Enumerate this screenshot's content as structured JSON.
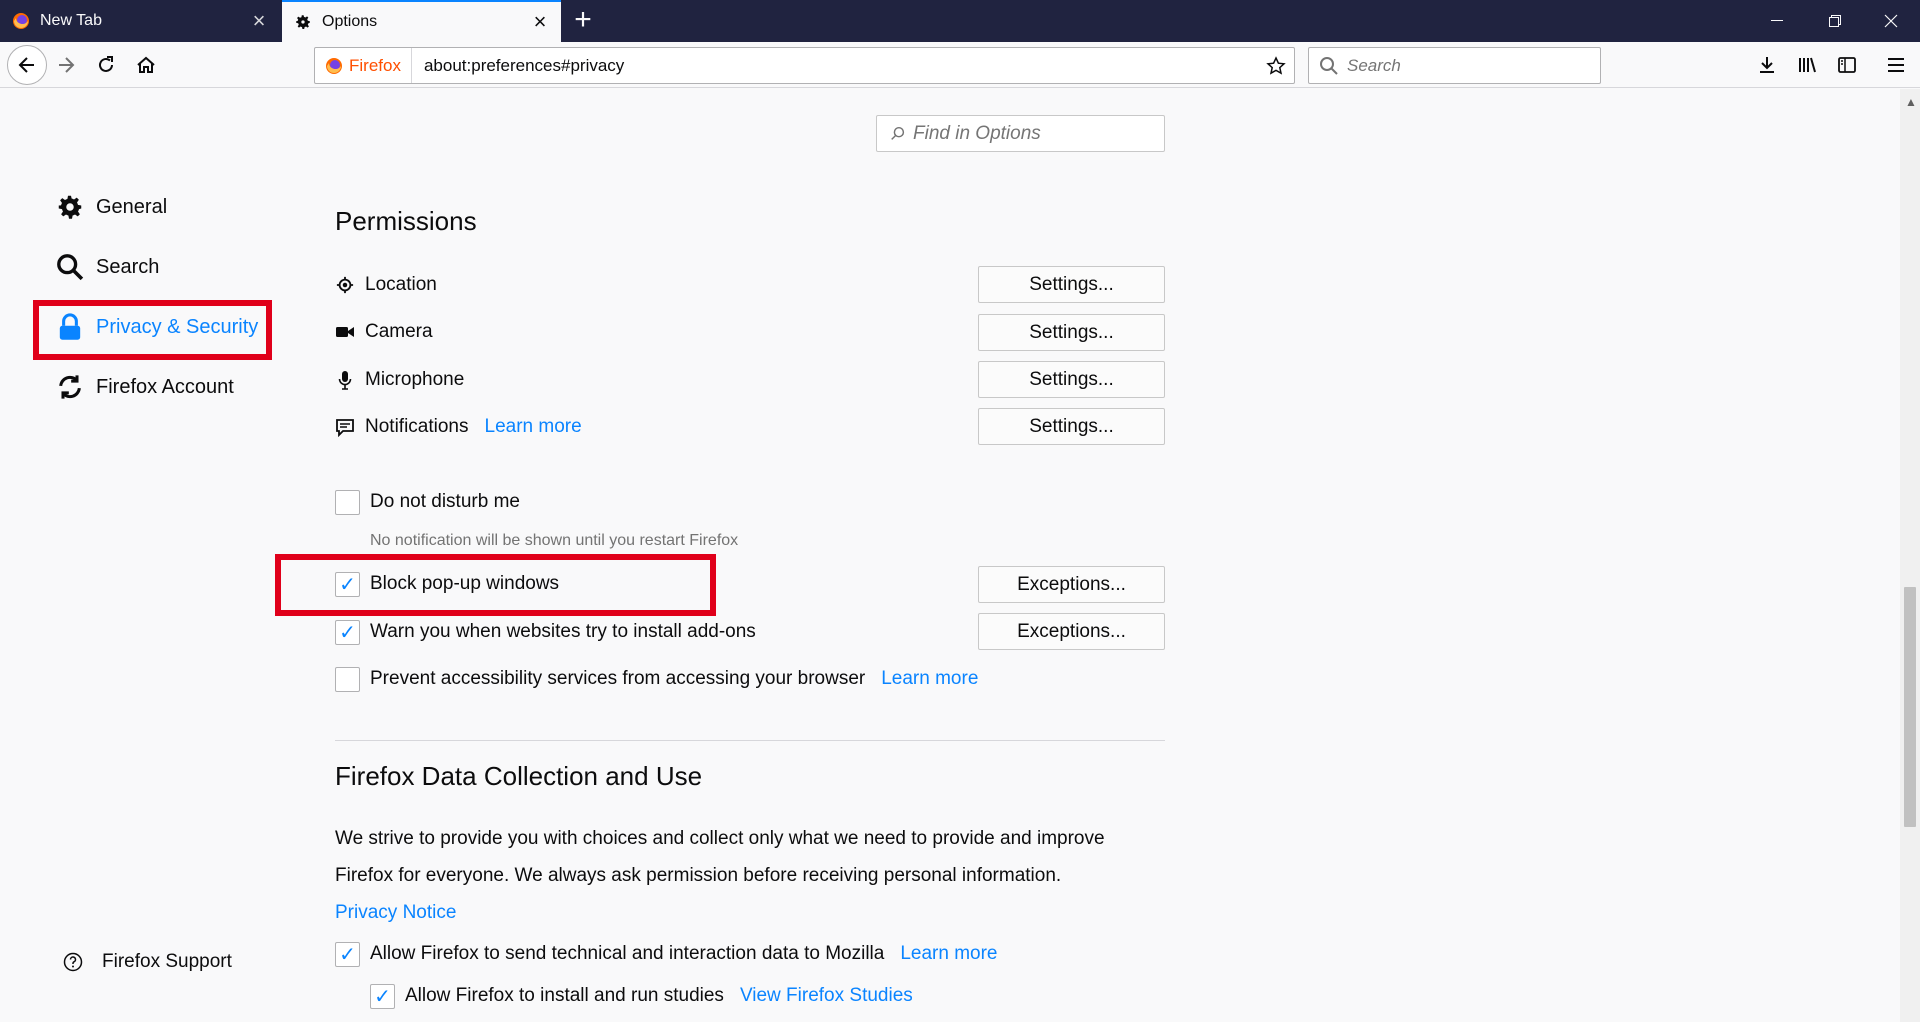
{
  "tabs": [
    {
      "title": "New Tab",
      "active": false
    },
    {
      "title": "Options",
      "active": true
    }
  ],
  "toolbar": {
    "identity_label": "Firefox",
    "url": "about:preferences#privacy",
    "search_placeholder": "Search"
  },
  "find": {
    "placeholder": "Find in Options"
  },
  "sidebar": {
    "items": [
      {
        "label": "General",
        "icon": "gear-icon"
      },
      {
        "label": "Search",
        "icon": "search-icon"
      },
      {
        "label": "Privacy & Security",
        "icon": "lock-icon",
        "selected": true
      },
      {
        "label": "Firefox Account",
        "icon": "sync-icon"
      }
    ],
    "support_label": "Firefox Support"
  },
  "permissions": {
    "heading": "Permissions",
    "rows": [
      {
        "label": "Location",
        "icon": "location-icon",
        "button": "Settings..."
      },
      {
        "label": "Camera",
        "icon": "camera-icon",
        "button": "Settings..."
      },
      {
        "label": "Microphone",
        "icon": "microphone-icon",
        "button": "Settings..."
      },
      {
        "label": "Notifications",
        "icon": "notification-icon",
        "link": "Learn more",
        "button": "Settings..."
      }
    ],
    "do_not_disturb": {
      "label": "Do not disturb me",
      "checked": false,
      "note": "No notification will be shown until you restart Firefox"
    },
    "block_popups": {
      "label": "Block pop-up windows",
      "checked": true,
      "button": "Exceptions..."
    },
    "warn_addons": {
      "label": "Warn you when websites try to install add-ons",
      "checked": true,
      "button": "Exceptions..."
    },
    "prevent_accessibility": {
      "label": "Prevent accessibility services from accessing your browser",
      "checked": false,
      "link": "Learn more"
    }
  },
  "data_collection": {
    "heading": "Firefox Data Collection and Use",
    "line1": "We strive to provide you with choices and collect only what we need to provide and improve",
    "line2": "Firefox for everyone. We always ask permission before receiving personal information.",
    "privacy_notice": "Privacy Notice",
    "send_data": {
      "label": "Allow Firefox to send technical and interaction data to Mozilla",
      "checked": true,
      "link": "Learn more"
    },
    "studies": {
      "label": "Allow Firefox to install and run studies",
      "checked": true,
      "link": "View Firefox Studies"
    }
  },
  "colors": {
    "accent": "#0a84ff",
    "highlight": "#e0001a",
    "tabbar": "#202340"
  }
}
